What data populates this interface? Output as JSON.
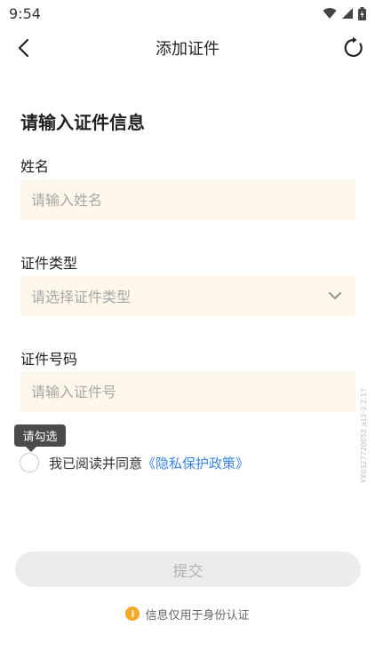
{
  "status_bar": {
    "time": "9:54",
    "icons": [
      "wifi-icon",
      "signal-icon",
      "battery-icon"
    ]
  },
  "nav": {
    "title": "添加证件",
    "back_icon": "chevron-left-icon",
    "refresh_icon": "refresh-icon"
  },
  "form": {
    "section_title": "请输入证件信息",
    "name": {
      "label": "姓名",
      "placeholder": "请输入姓名",
      "value": ""
    },
    "id_type": {
      "label": "证件类型",
      "placeholder": "请选择证件类型",
      "icon": "chevron-down-icon"
    },
    "id_number": {
      "label": "证件号码",
      "placeholder": "请输入证件号",
      "value": ""
    }
  },
  "tooltip": {
    "text": "请勾选"
  },
  "agreement": {
    "checked": false,
    "text": "我已阅读并同意",
    "link": "《隐私保护政策》"
  },
  "submit": {
    "label": "提交"
  },
  "footer": {
    "icon": "info-icon",
    "text": "信息仅用于身份认证"
  },
  "watermark": {
    "text": "YX0327720052 a12-2.2.17"
  },
  "colors": {
    "field_background": "#fdf6ea",
    "link": "#3a86e0",
    "info": "#f5a623",
    "button_disabled": "#ececec"
  }
}
